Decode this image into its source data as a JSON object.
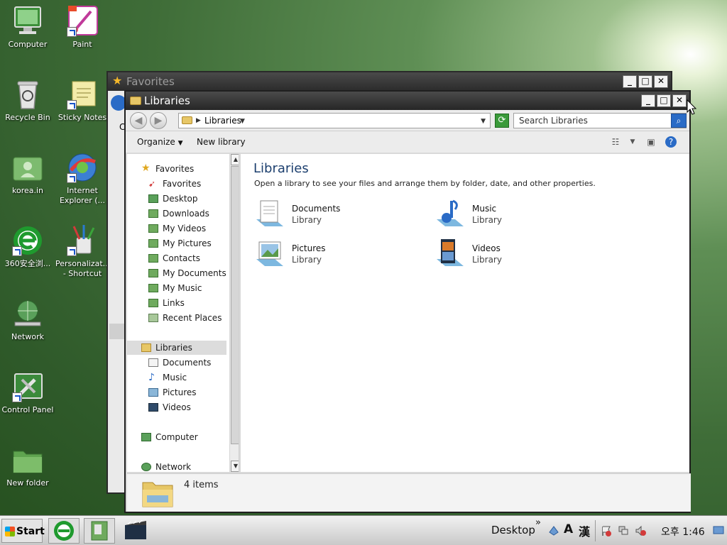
{
  "desktop": {
    "icons": [
      {
        "label": "Computer",
        "icon": "computer-icon"
      },
      {
        "label": "Paint",
        "icon": "paint-icon"
      },
      {
        "label": "Recycle Bin",
        "icon": "recycle-bin-icon"
      },
      {
        "label": "Sticky Notes",
        "icon": "sticky-notes-icon"
      },
      {
        "label": "korea.in",
        "icon": "user-folder-icon"
      },
      {
        "label": "Internet Explorer (...",
        "icon": "internet-explorer-icon"
      },
      {
        "label": "360安全浏...",
        "icon": "browser-360-icon"
      },
      {
        "label": "Personalizat... - Shortcut",
        "icon": "personalization-icon"
      },
      {
        "label": "Network",
        "icon": "network-icon"
      },
      {
        "label": "Control Panel",
        "icon": "control-panel-icon"
      },
      {
        "label": "New folder",
        "icon": "folder-icon"
      }
    ]
  },
  "bg_window": {
    "title": "Favorites",
    "partial_text": "C"
  },
  "window": {
    "title": "Libraries",
    "buttons": {
      "minimize": "_",
      "maximize": "□",
      "close": "✕"
    },
    "address": {
      "crumb": "Libraries"
    },
    "search": {
      "placeholder": "Search Libraries"
    },
    "toolbar": {
      "organize": "Organize",
      "new_library": "New library"
    },
    "nav": {
      "favorites_header": "Favorites",
      "favorites": [
        "Favorites",
        "Desktop",
        "Downloads",
        "My Videos",
        "My Pictures",
        "Contacts",
        "My Documents",
        "My Music",
        "Links",
        "Recent Places"
      ],
      "libraries_header": "Libraries",
      "libraries": [
        "Documents",
        "Music",
        "Pictures",
        "Videos"
      ],
      "computer": "Computer",
      "network": "Network"
    },
    "content": {
      "heading": "Libraries",
      "description": "Open a library to see your files and arrange them by folder, date, and other properties.",
      "items": [
        {
          "name": "Documents",
          "type": "Library",
          "icon": "documents-library-icon"
        },
        {
          "name": "Music",
          "type": "Library",
          "icon": "music-library-icon"
        },
        {
          "name": "Pictures",
          "type": "Library",
          "icon": "pictures-library-icon"
        },
        {
          "name": "Videos",
          "type": "Library",
          "icon": "videos-library-icon"
        }
      ]
    },
    "details": {
      "count": "4 items"
    }
  },
  "taskbar": {
    "start": "Start",
    "desktop_label": "Desktop",
    "chevron": "»",
    "ime_a": "A",
    "ime_han": "漢",
    "clock": "오후 1:46"
  }
}
